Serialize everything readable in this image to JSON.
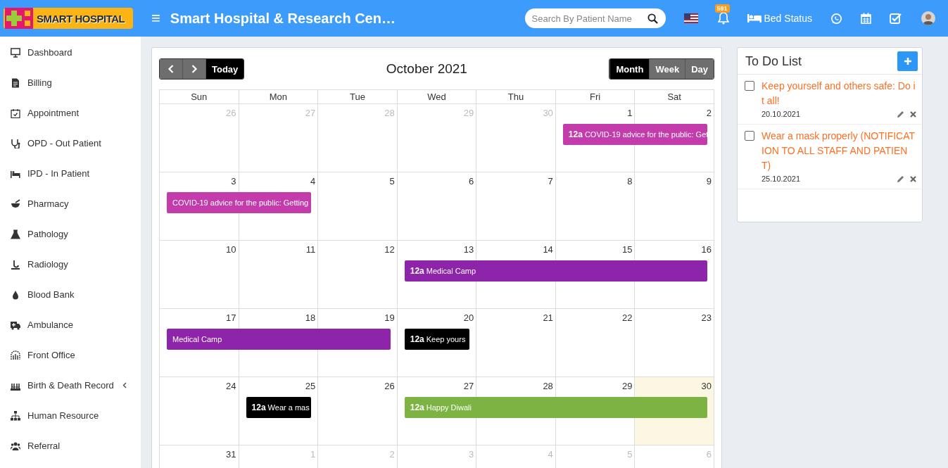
{
  "header": {
    "logo": "SMART HOSPITAL",
    "menu_glyph": "≡",
    "title": "Smart Hospital & Research Cen…",
    "search": {
      "placeholder": "Search By Patient Name"
    },
    "notification_count": "591",
    "bed_status": "Bed Status"
  },
  "sidebar": {
    "items": [
      {
        "label": "Dashboard",
        "expandable": false
      },
      {
        "label": "Billing",
        "expandable": false
      },
      {
        "label": "Appointment",
        "expandable": false
      },
      {
        "label": "OPD - Out Patient",
        "expandable": false
      },
      {
        "label": "IPD - In Patient",
        "expandable": false
      },
      {
        "label": "Pharmacy",
        "expandable": false
      },
      {
        "label": "Pathology",
        "expandable": false
      },
      {
        "label": "Radiology",
        "expandable": false
      },
      {
        "label": "Blood Bank",
        "expandable": false
      },
      {
        "label": "Ambulance",
        "expandable": false
      },
      {
        "label": "Front Office",
        "expandable": false
      },
      {
        "label": "Birth & Death Record",
        "expandable": true
      },
      {
        "label": "Human Resource",
        "expandable": false
      },
      {
        "label": "Referral",
        "expandable": false
      }
    ]
  },
  "calendar": {
    "today_button": "Today",
    "title": "October 2021",
    "views": [
      {
        "label": "Month",
        "selected": true
      },
      {
        "label": "Week",
        "selected": false
      },
      {
        "label": "Day",
        "selected": false
      }
    ],
    "weekdays": [
      "Sun",
      "Mon",
      "Tue",
      "Wed",
      "Thu",
      "Fri",
      "Sat"
    ],
    "weeks": [
      {
        "days": [
          {
            "label": "26",
            "other_month": true,
            "today": false,
            "event_continues": false
          },
          {
            "label": "27",
            "other_month": true,
            "today": false,
            "event_continues": false
          },
          {
            "label": "28",
            "other_month": true,
            "today": false,
            "event_continues": false
          },
          {
            "label": "29",
            "other_month": true,
            "today": false,
            "event_continues": false
          },
          {
            "label": "30",
            "other_month": true,
            "today": false,
            "event_continues": false
          },
          {
            "label": "1",
            "other_month": false,
            "today": false,
            "event_continues": false,
            "events": [
              {
                "time": "12a",
                "title": "COVID-19 advice for the public: Get",
                "color": "#c43bac"
              }
            ]
          },
          {
            "label": "2",
            "other_month": false,
            "today": false,
            "event_continues": true
          }
        ]
      },
      {
        "days": [
          {
            "label": "3",
            "other_month": false,
            "today": false,
            "event_continues": false,
            "events": [
              {
                "title": "COVID-19 advice for the public: Getting",
                "color": "#c43bac"
              }
            ]
          },
          {
            "label": "4",
            "other_month": false,
            "today": false,
            "event_continues": true
          },
          {
            "label": "5",
            "other_month": false,
            "today": false,
            "event_continues": false
          },
          {
            "label": "6",
            "other_month": false,
            "today": false,
            "event_continues": false
          },
          {
            "label": "7",
            "other_month": false,
            "today": false,
            "event_continues": false
          },
          {
            "label": "8",
            "other_month": false,
            "today": false,
            "event_continues": false
          },
          {
            "label": "9",
            "other_month": false,
            "today": false,
            "event_continues": false
          }
        ]
      },
      {
        "days": [
          {
            "label": "10",
            "other_month": false,
            "today": false,
            "event_continues": false
          },
          {
            "label": "11",
            "other_month": false,
            "today": false,
            "event_continues": false
          },
          {
            "label": "12",
            "other_month": false,
            "today": false,
            "event_continues": false
          },
          {
            "label": "13",
            "other_month": false,
            "today": false,
            "event_continues": false,
            "events": [
              {
                "time": "12a",
                "title": "Medical Camp",
                "color": "#8e24aa"
              }
            ]
          },
          {
            "label": "14",
            "other_month": false,
            "today": false,
            "event_continues": true
          },
          {
            "label": "15",
            "other_month": false,
            "today": false,
            "event_continues": true
          },
          {
            "label": "16",
            "other_month": false,
            "today": false,
            "event_continues": true
          }
        ]
      },
      {
        "days": [
          {
            "label": "17",
            "other_month": false,
            "today": false,
            "event_continues": false,
            "events": [
              {
                "title": "Medical Camp",
                "color": "#8e24aa"
              }
            ]
          },
          {
            "label": "18",
            "other_month": false,
            "today": false,
            "event_continues": true
          },
          {
            "label": "19",
            "other_month": false,
            "today": false,
            "event_continues": true
          },
          {
            "label": "20",
            "other_month": false,
            "today": false,
            "event_continues": false,
            "events": [
              {
                "time": "12a",
                "title": "Keep yours",
                "color": "#000000"
              }
            ]
          },
          {
            "label": "21",
            "other_month": false,
            "today": false,
            "event_continues": false
          },
          {
            "label": "22",
            "other_month": false,
            "today": false,
            "event_continues": false
          },
          {
            "label": "23",
            "other_month": false,
            "today": false,
            "event_continues": false
          }
        ]
      },
      {
        "days": [
          {
            "label": "24",
            "other_month": false,
            "today": false,
            "event_continues": false
          },
          {
            "label": "25",
            "other_month": false,
            "today": false,
            "event_continues": false,
            "events": [
              {
                "time": "12a",
                "title": "Wear a mas",
                "color": "#000000"
              }
            ]
          },
          {
            "label": "26",
            "other_month": false,
            "today": false,
            "event_continues": false
          },
          {
            "label": "27",
            "other_month": false,
            "today": false,
            "event_continues": false,
            "events": [
              {
                "time": "12a",
                "title": "Happy Diwali",
                "color": "#7cb342"
              }
            ]
          },
          {
            "label": "28",
            "other_month": false,
            "today": false,
            "event_continues": true
          },
          {
            "label": "29",
            "other_month": false,
            "today": false,
            "event_continues": true
          },
          {
            "label": "30",
            "other_month": false,
            "today": true,
            "event_continues": true
          }
        ]
      },
      {
        "days": [
          {
            "label": "31",
            "other_month": false,
            "today": false,
            "event_continues": false
          },
          {
            "label": "1",
            "other_month": true,
            "today": false,
            "event_continues": false
          },
          {
            "label": "2",
            "other_month": true,
            "today": false,
            "event_continues": false
          },
          {
            "label": "3",
            "other_month": true,
            "today": false,
            "event_continues": false
          },
          {
            "label": "4",
            "other_month": true,
            "today": false,
            "event_continues": false
          },
          {
            "label": "5",
            "other_month": true,
            "today": false,
            "event_continues": false
          },
          {
            "label": "6",
            "other_month": true,
            "today": false,
            "event_continues": false
          }
        ]
      }
    ]
  },
  "todo": {
    "title": "To Do List",
    "items": [
      {
        "text": "Keep yourself and others safe: Do it all!",
        "date": "20.10.2021",
        "checked": false
      },
      {
        "text": "Wear a mask properly (NOTIFICATION TO ALL STAFF AND PATIENT)",
        "date": "25.10.2021",
        "checked": false
      }
    ]
  }
}
